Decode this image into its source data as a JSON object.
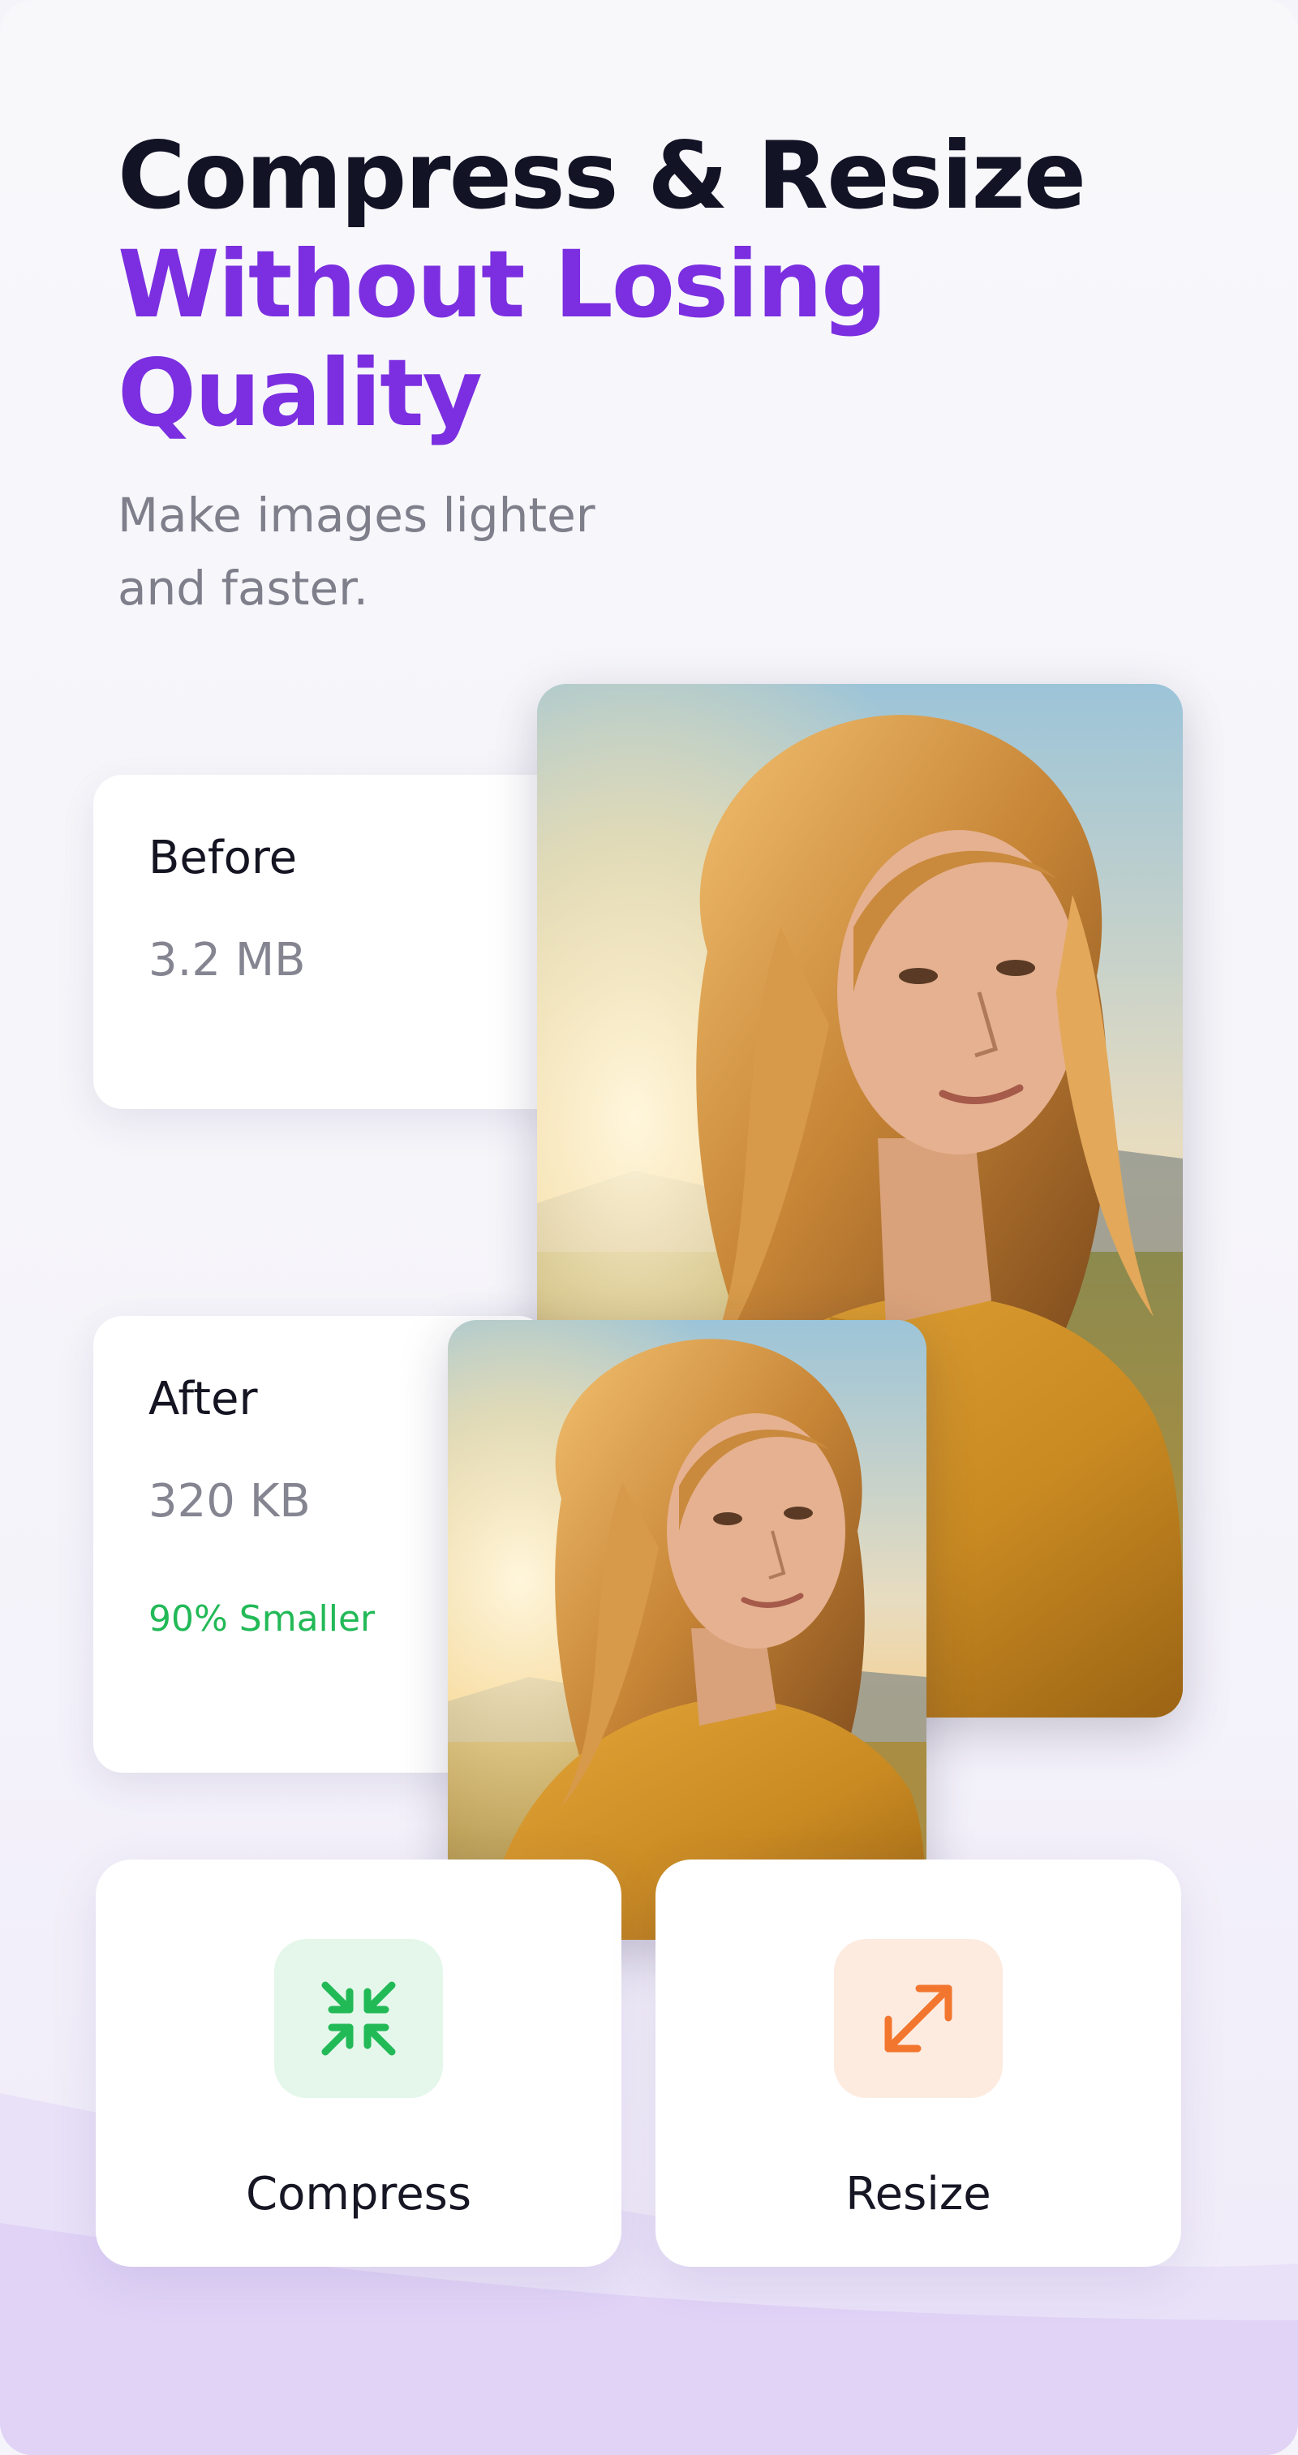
{
  "headline": {
    "line1": "Compress & Resize",
    "line2": "Without Losing",
    "line3": "Quality"
  },
  "subtitle": {
    "line1": "Make images lighter",
    "line2": "and faster."
  },
  "before": {
    "label": "Before",
    "size": "3.2 MB"
  },
  "after": {
    "label": "After",
    "size": "320 KB",
    "badge": "90% Smaller"
  },
  "actions": [
    {
      "label": "Compress",
      "icon": "compress-arrows-icon",
      "color": "#22b957",
      "tile": "#e4f7ea"
    },
    {
      "label": "Resize",
      "icon": "resize-arrow-icon",
      "color": "#f2762e",
      "tile": "#fdebe0"
    }
  ],
  "colors": {
    "accent": "#7b2fe0",
    "headline": "#131326",
    "success": "#22b957",
    "wave": "#e2d6f7"
  }
}
